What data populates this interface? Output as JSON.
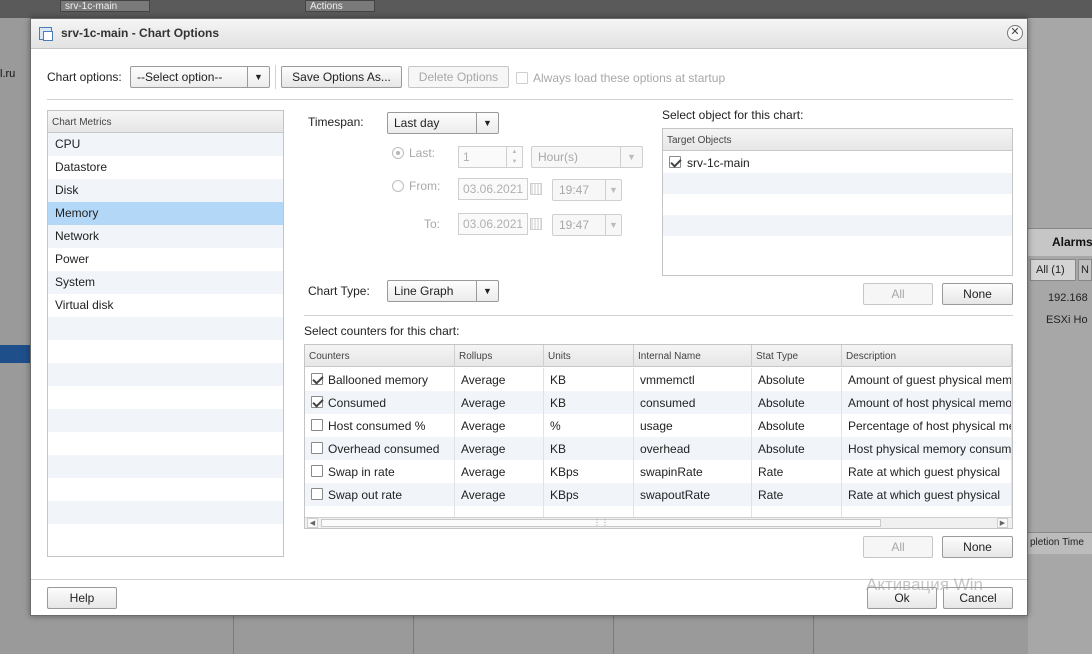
{
  "background": {
    "left_text": "l.ru",
    "top_mini": [
      "srv-1c-main",
      "Actions"
    ],
    "right_alarms_title": "Alarms",
    "right_alarms_tab": "All (1)",
    "right_alarms_tab2": "N",
    "right_row1": "192.168",
    "right_row2": "ESXi Ho",
    "right_col_header": "pletion Time"
  },
  "dialog": {
    "title": "srv-1c-main - Chart Options",
    "toolbar": {
      "chart_options_label": "Chart options:",
      "select_value": "--Select option--",
      "save_label": "Save Options As...",
      "delete_label": "Delete Options",
      "always_load_label": "Always load these options at startup"
    },
    "metrics": {
      "header": "Chart Metrics",
      "items": [
        "CPU",
        "Datastore",
        "Disk",
        "Memory",
        "Network",
        "Power",
        "System",
        "Virtual disk"
      ],
      "selected": "Memory"
    },
    "timespan": {
      "label": "Timespan:",
      "value": "Last day",
      "last_label": "Last:",
      "last_value": "1",
      "last_unit": "Hour(s)",
      "from_label": "From:",
      "from_date": "03.06.2021",
      "from_time": "19:47",
      "to_label": "To:",
      "to_date": "03.06.2021",
      "to_time": "19:47"
    },
    "chart_type": {
      "label": "Chart Type:",
      "value": "Line Graph"
    },
    "objects": {
      "label": "Select object for this chart:",
      "header": "Target Objects",
      "items": [
        {
          "name": "srv-1c-main",
          "checked": true
        }
      ],
      "all_label": "All",
      "none_label": "None"
    },
    "counters": {
      "label": "Select counters for this chart:",
      "columns": [
        "Counters",
        "Rollups",
        "Units",
        "Internal Name",
        "Stat Type",
        "Description"
      ],
      "rows": [
        {
          "checked": true,
          "counter": "Ballooned memory",
          "rollup": "Average",
          "units": "KB",
          "internal": "vmmemctl",
          "stat": "Absolute",
          "desc": "Amount of guest physical memory"
        },
        {
          "checked": true,
          "counter": "Consumed",
          "rollup": "Average",
          "units": "KB",
          "internal": "consumed",
          "stat": "Absolute",
          "desc": "Amount of host physical memory"
        },
        {
          "checked": false,
          "counter": "Host consumed %",
          "rollup": "Average",
          "units": "%",
          "internal": "usage",
          "stat": "Absolute",
          "desc": "Percentage of host physical memory"
        },
        {
          "checked": false,
          "counter": "Overhead consumed",
          "rollup": "Average",
          "units": "KB",
          "internal": "overhead",
          "stat": "Absolute",
          "desc": "Host physical memory consumed"
        },
        {
          "checked": false,
          "counter": "Swap in rate",
          "rollup": "Average",
          "units": "KBps",
          "internal": "swapinRate",
          "stat": "Rate",
          "desc": "Rate at which guest physical"
        },
        {
          "checked": false,
          "counter": "Swap out rate",
          "rollup": "Average",
          "units": "KBps",
          "internal": "swapoutRate",
          "stat": "Rate",
          "desc": "Rate at which guest physical"
        }
      ],
      "all_label": "All",
      "none_label": "None"
    },
    "footer": {
      "help_label": "Help",
      "ok_label": "Ok",
      "cancel_label": "Cancel"
    },
    "watermark": "Активация Win"
  }
}
